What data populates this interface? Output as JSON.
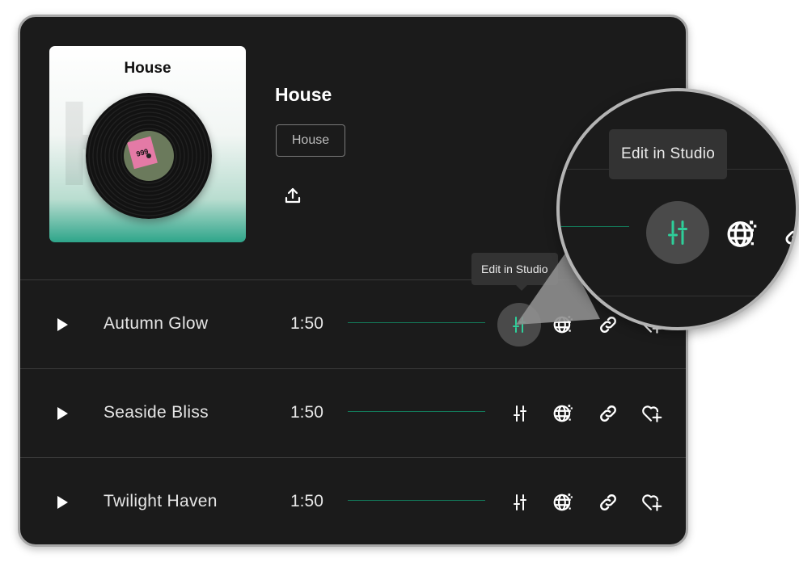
{
  "playlist": {
    "title": "House",
    "tag": "House",
    "cover": {
      "title": "House",
      "bg_text": "Ho",
      "sticker": "999"
    }
  },
  "tracks": [
    {
      "title": "Autumn Glow",
      "duration": "1:50"
    },
    {
      "title": "Seaside Bliss",
      "duration": "1:50"
    },
    {
      "title": "Twilight Haven",
      "duration": "1:50"
    }
  ],
  "tooltip": {
    "text": "Edit in Studio"
  },
  "magnifier": {
    "tooltip_text": "Edit in Studio"
  },
  "icons": {
    "play": "play-icon",
    "share": "upload-icon",
    "studio": "sliders-icon",
    "remix": "globe-icon",
    "link": "link-icon",
    "favorite": "heart-plus-icon"
  },
  "colors": {
    "background": "#1b1b1b",
    "accent": "#2ecf9a",
    "active_button": "#4a4a4a",
    "text": "#e6e6e6"
  }
}
